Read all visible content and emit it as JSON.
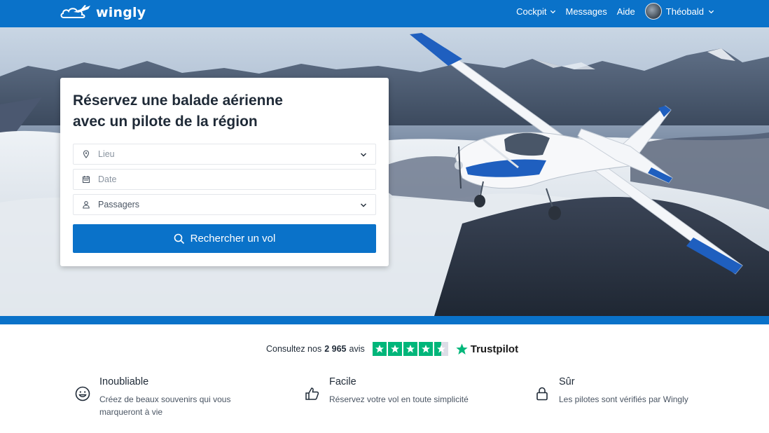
{
  "header": {
    "brand": "wingly",
    "nav": [
      {
        "label": "Cockpit",
        "has_dropdown": true
      },
      {
        "label": "Messages",
        "has_dropdown": false
      },
      {
        "label": "Aide",
        "has_dropdown": false
      }
    ],
    "user": {
      "name": "Théobald",
      "has_dropdown": true
    }
  },
  "search_card": {
    "title_line1": "Réservez une balade aérienne",
    "title_line2": "avec un pilote de la région",
    "fields": {
      "location": {
        "placeholder": "Lieu",
        "icon": "map-pin-icon"
      },
      "date": {
        "placeholder": "Date",
        "icon": "calendar-icon"
      },
      "passengers": {
        "value": "Passagers",
        "icon": "user-icon"
      }
    },
    "search_button": "Rechercher un vol"
  },
  "trustpilot": {
    "prefix": "Consultez nos",
    "count": "2 965",
    "suffix": "avis",
    "rating_stars": 4.5,
    "brand": "Trustpilot"
  },
  "features": [
    {
      "title": "Inoubliable",
      "desc": "Créez de beaux souvenirs qui vous marqueront à vie",
      "icon": "smile-icon"
    },
    {
      "title": "Facile",
      "desc": "Réservez votre vol en toute simplicité",
      "icon": "thumbs-up-icon"
    },
    {
      "title": "Sûr",
      "desc": "Les pilotes sont vérifiés par Wingly",
      "icon": "lock-icon"
    }
  ],
  "colors": {
    "brand_blue": "#0a72c9",
    "trustpilot_green": "#00b67a"
  }
}
